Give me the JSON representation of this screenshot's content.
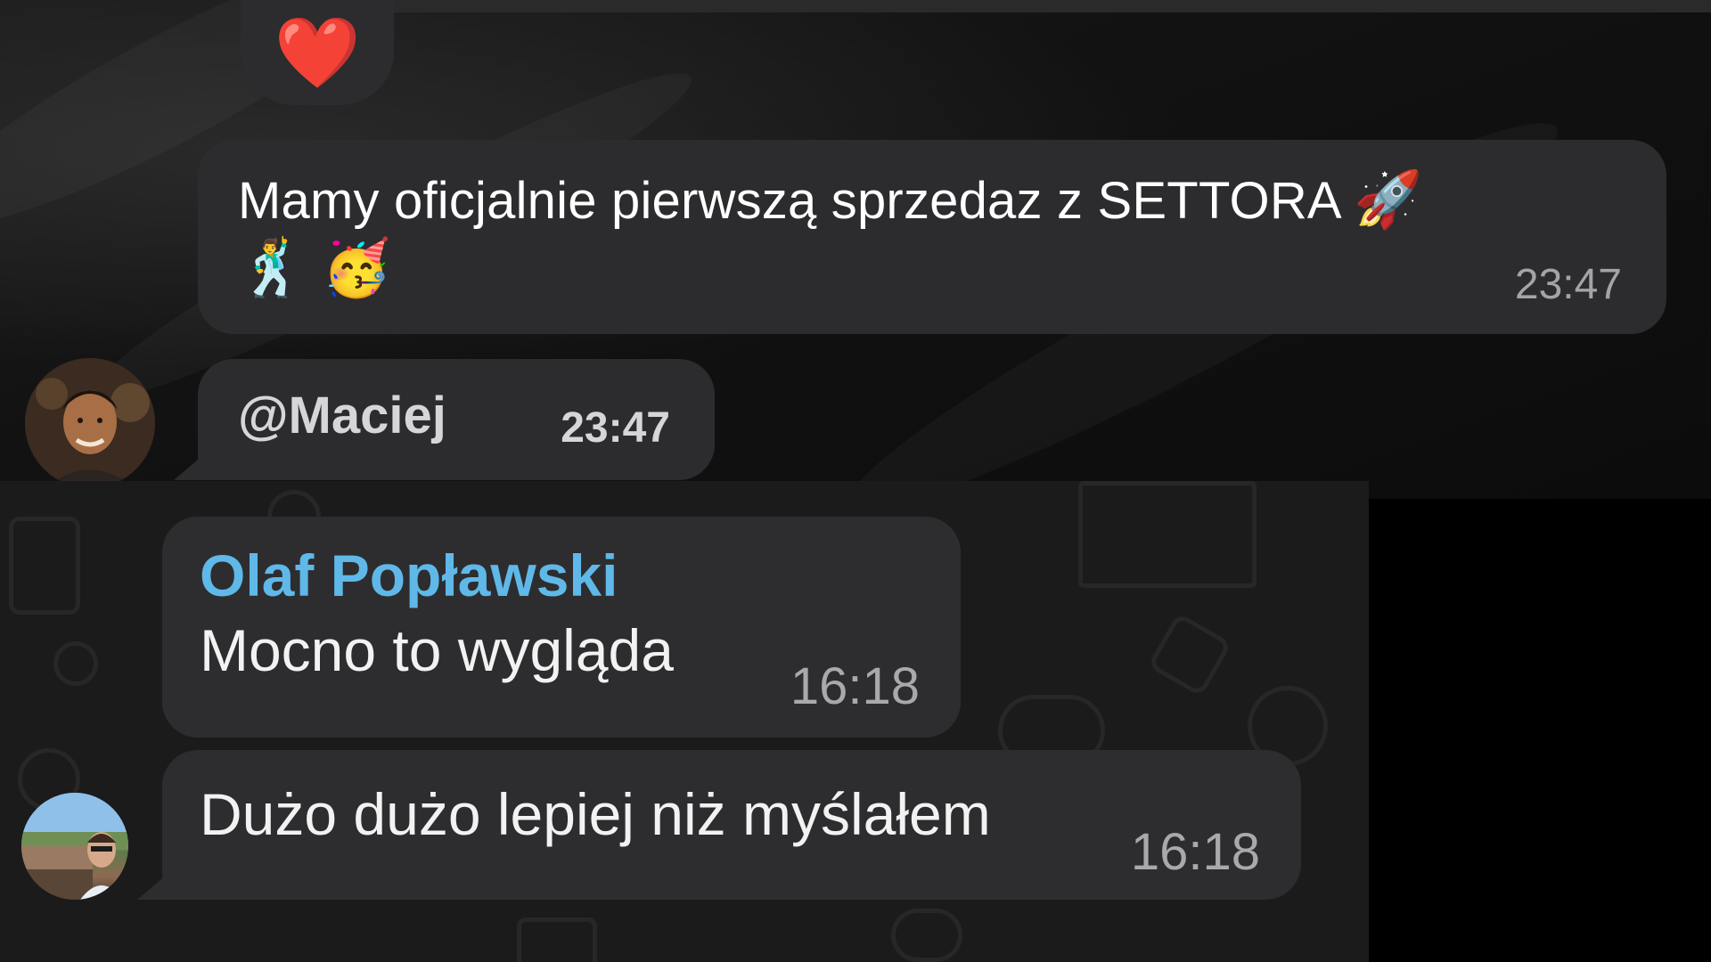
{
  "top_chat": {
    "reaction": {
      "emoji": "❤️",
      "icon": "red-heart-icon"
    },
    "message_1": {
      "text": "Mamy oficjalnie pierwszą sprzedaz z SETTORA",
      "emoji_inline": "🚀",
      "emoji_line2": "🕺 🥳",
      "time": "23:47"
    },
    "message_2": {
      "mention": "@Maciej",
      "time": "23:47"
    },
    "avatar": {
      "icon": "user-avatar-icon"
    }
  },
  "bottom_chat": {
    "message_1": {
      "sender": "Olaf Popławski",
      "sender_color": "#5fb8e8",
      "text": "Mocno to wygląda",
      "time": "16:18"
    },
    "message_2": {
      "text": "Dużo dużo lepiej niż myślałem",
      "time": "16:18"
    },
    "avatar": {
      "icon": "user-avatar-icon"
    }
  },
  "colors": {
    "bubble": "#2c2c2e",
    "time_text": "#a3a3a8",
    "sender_name": "#5fb8e8"
  }
}
